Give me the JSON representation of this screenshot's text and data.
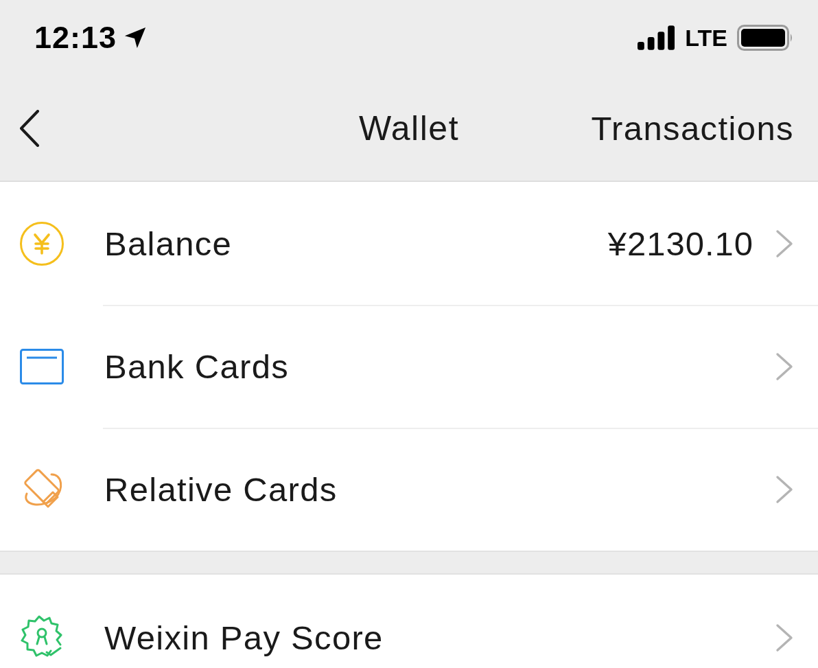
{
  "status_bar": {
    "time": "12:13",
    "network": "LTE"
  },
  "nav_bar": {
    "title": "Wallet",
    "action": "Transactions"
  },
  "sections": [
    {
      "items": [
        {
          "label": "Balance",
          "value": "¥2130.10"
        },
        {
          "label": "Bank Cards"
        },
        {
          "label": "Relative Cards"
        }
      ]
    },
    {
      "items": [
        {
          "label": "Weixin Pay Score"
        }
      ]
    }
  ]
}
